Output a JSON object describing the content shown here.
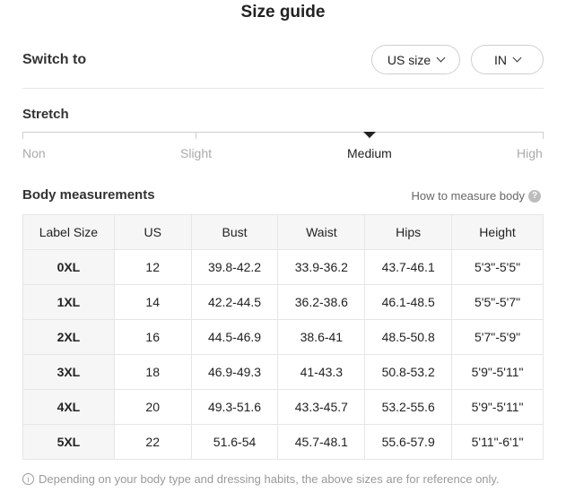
{
  "title": "Size guide",
  "switch": {
    "label": "Switch to",
    "size_system": "US size",
    "unit": "IN"
  },
  "stretch": {
    "title": "Stretch",
    "levels": [
      "Non",
      "Slight",
      "Medium",
      "High"
    ],
    "selected": "Medium"
  },
  "measurements": {
    "title": "Body measurements",
    "how_to": "How to measure body",
    "help_icon": "question-icon",
    "headers": [
      "Label Size",
      "US",
      "Bust",
      "Waist",
      "Hips",
      "Height"
    ],
    "rows": [
      [
        "0XL",
        "12",
        "39.8-42.2",
        "33.9-36.2",
        "43.7-46.1",
        "5'3\"-5'5\""
      ],
      [
        "1XL",
        "14",
        "42.2-44.5",
        "36.2-38.6",
        "46.1-48.5",
        "5'5\"-5'7\""
      ],
      [
        "2XL",
        "16",
        "44.5-46.9",
        "38.6-41",
        "48.5-50.8",
        "5'7\"-5'9\""
      ],
      [
        "3XL",
        "18",
        "46.9-49.3",
        "41-43.3",
        "50.8-53.2",
        "5'9\"-5'11\""
      ],
      [
        "4XL",
        "20",
        "49.3-51.6",
        "43.3-45.7",
        "53.2-55.6",
        "5'9\"-5'11\""
      ],
      [
        "5XL",
        "22",
        "51.6-54",
        "45.7-48.1",
        "55.6-57.9",
        "5'11\"-6'1\""
      ]
    ]
  },
  "note": {
    "icon": "info-icon",
    "text": "Depending on your body type and dressing habits, the above sizes are for reference only."
  }
}
